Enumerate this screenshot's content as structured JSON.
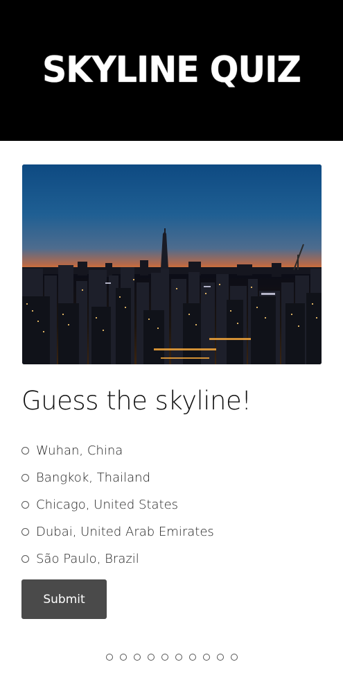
{
  "header": {
    "logo_text": "Skyline Quiz"
  },
  "quiz": {
    "image_icon": "city-skyline-photo",
    "question": "Guess the skyline!",
    "options": [
      {
        "label": "Wuhan, China"
      },
      {
        "label": "Bangkok, Thailand"
      },
      {
        "label": "Chicago, United States"
      },
      {
        "label": "Dubai, United Arab Emirates"
      },
      {
        "label": "São Paulo, Brazil"
      }
    ],
    "submit_label": "Submit"
  },
  "pagination": {
    "total_dots": 10
  },
  "colors": {
    "header_bg": "#000000",
    "button_bg": "#4a4a4a",
    "page_bg": "#ffffff"
  }
}
